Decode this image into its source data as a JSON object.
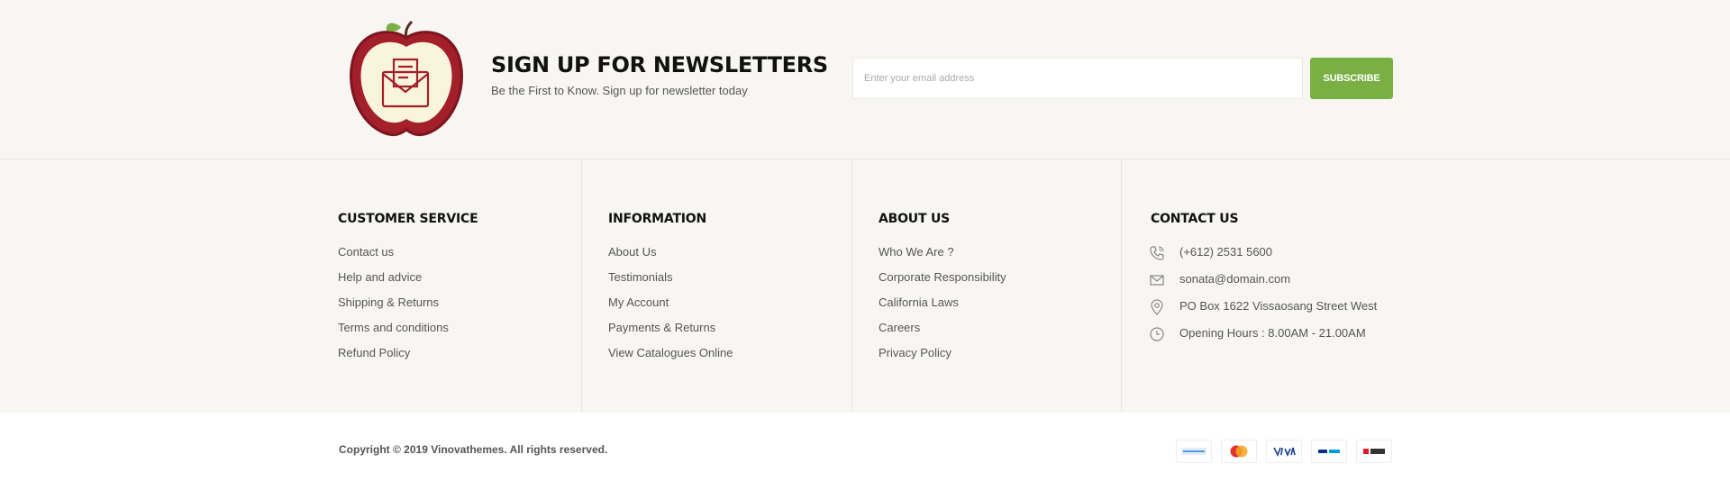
{
  "newsletter": {
    "title": "SIGN UP FOR NEWSLETTERS",
    "subtitle": "Be the First to Know. Sign up for newsletter today",
    "email_placeholder": "Enter your email address",
    "subscribe_label": "SUBSCRIBE",
    "accent_color": "#7ab043",
    "logo_icon": "apple-envelope-icon"
  },
  "footer": {
    "customer_service": {
      "title": "CUSTOMER SERVICE",
      "items": [
        "Contact us",
        "Help and advice",
        "Shipping & Returns",
        "Terms and conditions",
        "Refund Policy"
      ]
    },
    "information": {
      "title": "INFORMATION",
      "items": [
        "About Us",
        "Testimonials",
        "My Account",
        "Payments & Returns",
        "View Catalogues Online"
      ]
    },
    "about_us": {
      "title": "ABOUT US",
      "items": [
        "Who We Are ?",
        "Corporate Responsibility",
        "California Laws",
        "Careers",
        "Privacy Policy"
      ]
    },
    "contact_us": {
      "title": "CONTACT US",
      "phone": "(+612) 2531 5600",
      "email": "sonata@domain.com",
      "address": "PO Box 1622 Vissaosang Street West",
      "hours": "Opening Hours : 8.00AM - 21.00AM"
    }
  },
  "bottom": {
    "copyright": "Copyright © 2019 Vinovathemes. All rights reserved.",
    "payment_icons": [
      "american-express-icon",
      "mastercard-icon",
      "visa-icon",
      "paypal-icon",
      "dbs-icon"
    ]
  }
}
